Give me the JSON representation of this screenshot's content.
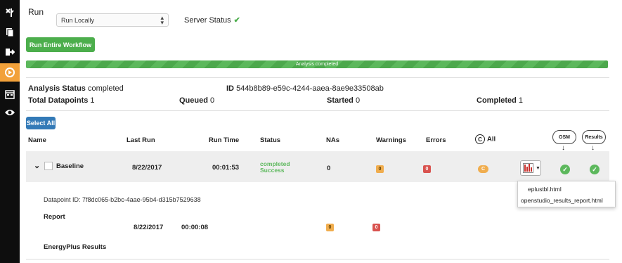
{
  "sidebar": {
    "icons": [
      "tools-icon",
      "documents-icon",
      "export-icon",
      "run-icon",
      "calendar-icon",
      "eye-icon"
    ],
    "active_index": 3,
    "accent_color": "#f2a13a"
  },
  "run_panel": {
    "run_label": "Run",
    "run_mode_selected": "Run Locally",
    "server_status_label": "Server Status",
    "server_status_icon": "checkmark-icon",
    "run_workflow_button": "Run Entire Workflow",
    "progress_text": "Analysis completed",
    "progress_percent": 100
  },
  "summary": {
    "analysis_status_label": "Analysis Status",
    "analysis_status_value": "completed",
    "id_label": "ID",
    "id_value": "544b8b89-e59c-4244-aaea-8ae9e33508ab",
    "total_datapoints_label": "Total Datapoints",
    "total_datapoints_value": "1",
    "queued_label": "Queued",
    "queued_value": "0",
    "started_label": "Started",
    "started_value": "0",
    "completed_label": "Completed",
    "completed_value": "1"
  },
  "table": {
    "select_all_button": "Select All",
    "headers": {
      "name": "Name",
      "last_run": "Last Run",
      "run_time": "Run Time",
      "status": "Status",
      "nas": "NAs",
      "warnings": "Warnings",
      "errors": "Errors",
      "all_symbol": "C",
      "all": "All",
      "osm": "OSM",
      "results": "Results"
    },
    "rows": [
      {
        "name": "Baseline",
        "last_run": "8/22/2017",
        "run_time": "00:01:53",
        "status_line1": "completed",
        "status_line2": "Success",
        "nas": "0",
        "warnings": "0",
        "errors": "0",
        "all_badge": "C",
        "datapoint_id_label": "Datapoint ID:",
        "datapoint_id": "7f8dc065-b2bc-4aae-95b4-d315b7529638",
        "report": {
          "label": "Report",
          "last_run": "8/22/2017",
          "run_time": "00:00:08",
          "warnings": "0",
          "errors": "0"
        },
        "energyplus_label": "EnergyPlus Results"
      }
    ]
  },
  "report_dropdown": {
    "items": [
      "eplustbl.html",
      "openstudio_results_report.html"
    ]
  }
}
